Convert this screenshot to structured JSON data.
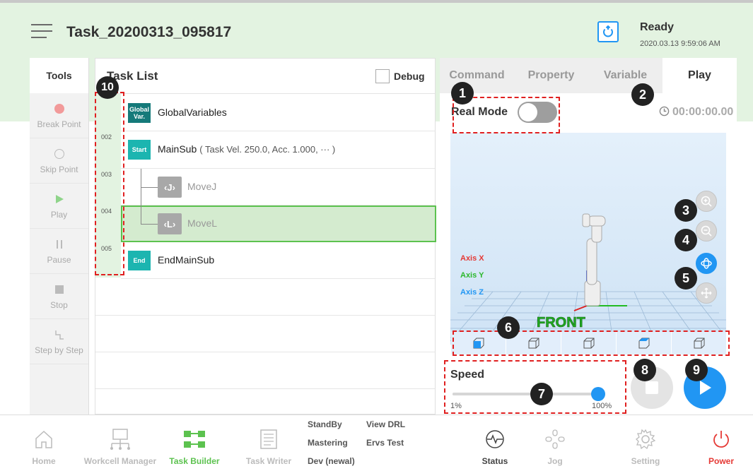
{
  "header": {
    "task_title": "Task_20200313_095817",
    "status": "Ready",
    "timestamp": "2020.03.13 9:59:06 AM"
  },
  "tools": {
    "title": "Tools",
    "items": [
      {
        "label": "Break Point",
        "icon": "dot-icon"
      },
      {
        "label": "Skip Point",
        "icon": "ring-icon"
      },
      {
        "label": "Play",
        "icon": "play-icon"
      },
      {
        "label": "Pause",
        "icon": "pause-icon"
      },
      {
        "label": "Stop",
        "icon": "stop-icon"
      },
      {
        "label": "Step by Step",
        "icon": "step-icon"
      }
    ]
  },
  "task_list": {
    "title": "Task List",
    "debug_label": "Debug",
    "line_numbers": [
      "002",
      "003",
      "004",
      "005"
    ],
    "rows": [
      {
        "badge": "Global Var.",
        "label": "GlobalVariables",
        "sub": ""
      },
      {
        "badge": "Start",
        "label": "MainSub",
        "sub": "( Task Vel. 250.0, Acc. 1.000, ··· )"
      },
      {
        "badge": "J",
        "label": "MoveJ",
        "sub": ""
      },
      {
        "badge": "L",
        "label": "MoveL",
        "sub": ""
      },
      {
        "badge": "End",
        "label": "EndMainSub",
        "sub": ""
      }
    ]
  },
  "right_panel": {
    "tabs": [
      "Command",
      "Property",
      "Variable",
      "Play"
    ],
    "active_tab": "Play",
    "real_mode_label": "Real Mode",
    "real_mode_on": false,
    "timer": "00:00:00.00",
    "axis_labels": [
      "Axis X",
      "Axis Y",
      "Axis Z"
    ],
    "view_label": "FRONT",
    "speed_label": "Speed",
    "speed_min": "1%",
    "speed_max": "100%",
    "speed_value": 100
  },
  "bottom_nav": {
    "items": [
      {
        "label": "Home",
        "icon": "home-icon"
      },
      {
        "label": "Workcell Manager",
        "icon": "workcell-icon"
      },
      {
        "label": "Task Builder",
        "icon": "task-builder-icon"
      },
      {
        "label": "Task Writer",
        "icon": "task-writer-icon"
      },
      {
        "label": "Status",
        "icon": "status-icon"
      },
      {
        "label": "Jog",
        "icon": "jog-icon"
      },
      {
        "label": "Setting",
        "icon": "gear-icon"
      },
      {
        "label": "Power",
        "icon": "power-icon"
      }
    ],
    "links": [
      "StandBy",
      "Mastering",
      "Dev (newal)",
      "View DRL",
      "Ervs Test"
    ]
  },
  "callouts": [
    "1",
    "2",
    "3",
    "4",
    "5",
    "6",
    "7",
    "8",
    "9",
    "10"
  ],
  "colors": {
    "accent": "#2196f3",
    "green": "#5cc24f",
    "teal": "#1cb5b0",
    "power": "#e53935",
    "annotation": "#e02020"
  }
}
